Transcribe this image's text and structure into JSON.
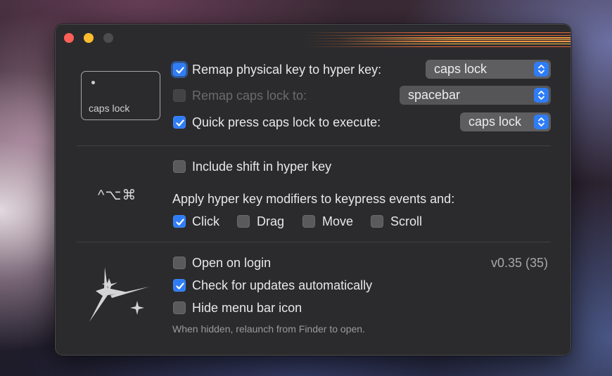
{
  "colors": {
    "accent": "#2f7df6",
    "window_bg": "#2b2b2d"
  },
  "keycap": {
    "label": "caps lock"
  },
  "remap": {
    "physical_label": "Remap physical key to hyper key:",
    "physical_value": "caps lock",
    "physical_checked": true,
    "capslock_label": "Remap caps lock to:",
    "capslock_value": "spacebar",
    "capslock_checked": false,
    "quickpress_label": "Quick press caps lock to execute:",
    "quickpress_value": "caps lock",
    "quickpress_checked": true
  },
  "modifiers": {
    "symbols": "^⌥⌘",
    "include_shift_label": "Include shift in hyper key",
    "include_shift_checked": false,
    "apply_label": "Apply hyper key modifiers to keypress events and:",
    "events": [
      {
        "label": "Click",
        "checked": true
      },
      {
        "label": "Drag",
        "checked": false
      },
      {
        "label": "Move",
        "checked": false
      },
      {
        "label": "Scroll",
        "checked": false
      }
    ]
  },
  "general": {
    "open_login_label": "Open on login",
    "open_login_checked": false,
    "version": "v0.35 (35)",
    "check_updates_label": "Check for updates automatically",
    "check_updates_checked": true,
    "hide_icon_label": "Hide menu bar icon",
    "hide_icon_checked": false,
    "hint": "When hidden, relaunch from Finder to open."
  },
  "icons": [
    "sparkles-icon",
    "chevron-updown-icon",
    "checkmark-icon"
  ]
}
